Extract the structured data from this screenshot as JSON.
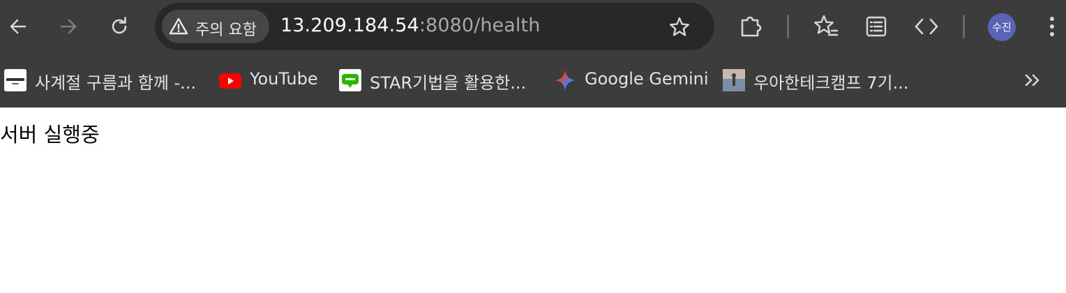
{
  "toolbar": {
    "back_icon": "arrow-left-icon",
    "forward_icon": "arrow-right-icon",
    "reload_icon": "reload-icon",
    "security_chip": {
      "icon": "warning-triangle-icon",
      "label": "주의 요함"
    },
    "url": {
      "host": "13.209.184.54",
      "rest": ":8080/health"
    },
    "bookmark_star_icon": "star-outline-icon",
    "extensions_icon": "puzzle-icon",
    "bookmarks_manager_icon": "star-list-icon",
    "reading_list_icon": "reading-list-icon",
    "devtools_icon": "code-brackets-icon",
    "profile_avatar_text": "수진",
    "menu_icon": "kebab-menu-icon"
  },
  "bookmarks": {
    "items": [
      {
        "label": "사계절 구름과 함께 -...",
        "favicon": "goormthon-favicon"
      },
      {
        "label": "YouTube",
        "favicon": "youtube-favicon"
      },
      {
        "label": "STAR기법을 활용한...",
        "favicon": "blog-favicon"
      },
      {
        "label": "Google Gemini",
        "favicon": "gemini-favicon"
      },
      {
        "label": "우아한테크캠프 7기...",
        "favicon": "photo-favicon"
      }
    ],
    "overflow_icon": "double-chevron-right-icon"
  },
  "page": {
    "text": "서버 실행중"
  },
  "colors": {
    "toolbar_bg": "#3c3c3c",
    "omnibox_bg": "#282828",
    "avatar_bg": "#5b63b7",
    "youtube_red": "#ff0000",
    "blog_green": "#2db400"
  }
}
